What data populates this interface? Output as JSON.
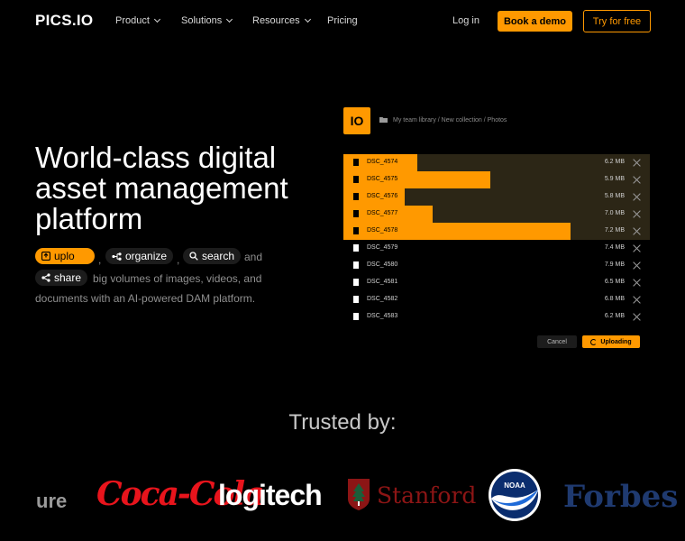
{
  "header": {
    "logo": "PICS.IO",
    "nav": [
      {
        "label": "Product",
        "has_dropdown": true
      },
      {
        "label": "Solutions",
        "has_dropdown": true
      },
      {
        "label": "Resources",
        "has_dropdown": true
      },
      {
        "label": "Pricing",
        "has_dropdown": false
      }
    ],
    "login": "Log in",
    "book_demo": "Book a demo",
    "try_free": "Try for free"
  },
  "hero": {
    "title": "World-class digital asset management platform",
    "chips": {
      "upload": "uplo",
      "organize": "organize",
      "search": "search",
      "share": "share"
    },
    "comma": ",",
    "and_text": "and",
    "line2": "big volumes of images, videos, and",
    "line3": "documents with an AI-powered DAM platform."
  },
  "app": {
    "logo": "IO",
    "breadcrumb": "My team library / New collection / Photos",
    "files": [
      {
        "name": "DSC_4574",
        "size": "6.2 MB",
        "state": "uploading",
        "progress": 0.24
      },
      {
        "name": "DSC_4575",
        "size": "5.9 MB",
        "state": "uploading",
        "progress": 0.48
      },
      {
        "name": "DSC_4576",
        "size": "5.8 MB",
        "state": "uploading",
        "progress": 0.2
      },
      {
        "name": "DSC_4577",
        "size": "7.0 MB",
        "state": "uploading",
        "progress": 0.29
      },
      {
        "name": "DSC_4578",
        "size": "7.2 MB",
        "state": "uploading",
        "progress": 0.74
      },
      {
        "name": "DSC_4579",
        "size": "7.4 MB",
        "state": "done"
      },
      {
        "name": "DSC_4580",
        "size": "7.9 MB",
        "state": "done"
      },
      {
        "name": "DSC_4581",
        "size": "6.5 MB",
        "state": "done"
      },
      {
        "name": "DSC_4582",
        "size": "6.8 MB",
        "state": "done"
      },
      {
        "name": "DSC_4583",
        "size": "6.2 MB",
        "state": "done"
      }
    ],
    "cancel": "Cancel",
    "uploading": "Uploading"
  },
  "trusted": {
    "heading": "Trusted by:",
    "brands": [
      "ure",
      "Coca-Cola",
      "logitech",
      "Stanford",
      "NOAA",
      "Forbes"
    ]
  },
  "colors": {
    "accent": "#ff9900",
    "background": "#000000",
    "muted_text": "#8f8f8f"
  }
}
